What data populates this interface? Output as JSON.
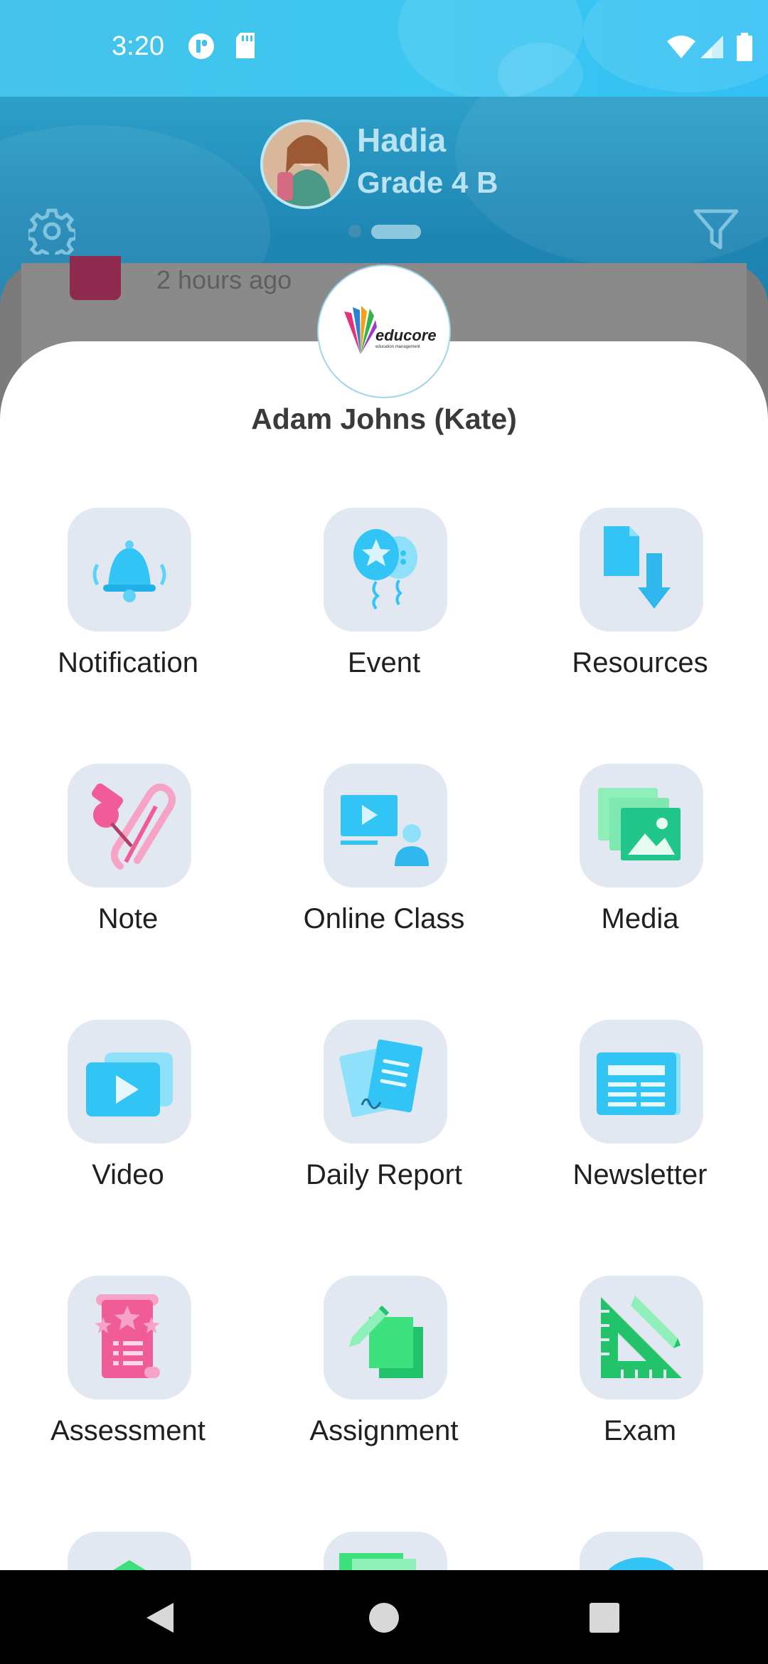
{
  "status_bar": {
    "time": "3:20",
    "icons": [
      "cast-icon",
      "sd-card-icon",
      "wifi-icon",
      "signal-icon",
      "battery-icon"
    ]
  },
  "header": {
    "student_name": "Hadia",
    "student_grade": "Grade 4 B",
    "icons": [
      "settings-gear-icon",
      "filter-icon"
    ]
  },
  "background_feed": {
    "time_ago": "2 hours ago"
  },
  "menu": {
    "logo_text": "educore",
    "logo_subtext": "education management",
    "user_name": "Adam Johns (Kate)",
    "items": [
      {
        "label": "Notification",
        "icon": "bell-icon"
      },
      {
        "label": "Event",
        "icon": "balloon-icon"
      },
      {
        "label": "Resources",
        "icon": "download-file-icon"
      },
      {
        "label": "Note",
        "icon": "pin-paperclip-icon"
      },
      {
        "label": "Online Class",
        "icon": "online-class-icon"
      },
      {
        "label": "Media",
        "icon": "media-gallery-icon"
      },
      {
        "label": "Video",
        "icon": "video-play-icon"
      },
      {
        "label": "Daily Report",
        "icon": "report-pages-icon"
      },
      {
        "label": "Newsletter",
        "icon": "newsletter-icon"
      },
      {
        "label": "Assessment",
        "icon": "scroll-stars-icon"
      },
      {
        "label": "Assignment",
        "icon": "assignment-pen-icon"
      },
      {
        "label": "Exam",
        "icon": "set-square-pencil-icon"
      }
    ]
  },
  "nav_bar": {
    "icons": [
      "back-icon",
      "home-icon",
      "recents-icon"
    ]
  },
  "colors": {
    "primary": "#33c0f4",
    "header": "#1f86b4",
    "tile_bg": "#e2e8f2"
  }
}
